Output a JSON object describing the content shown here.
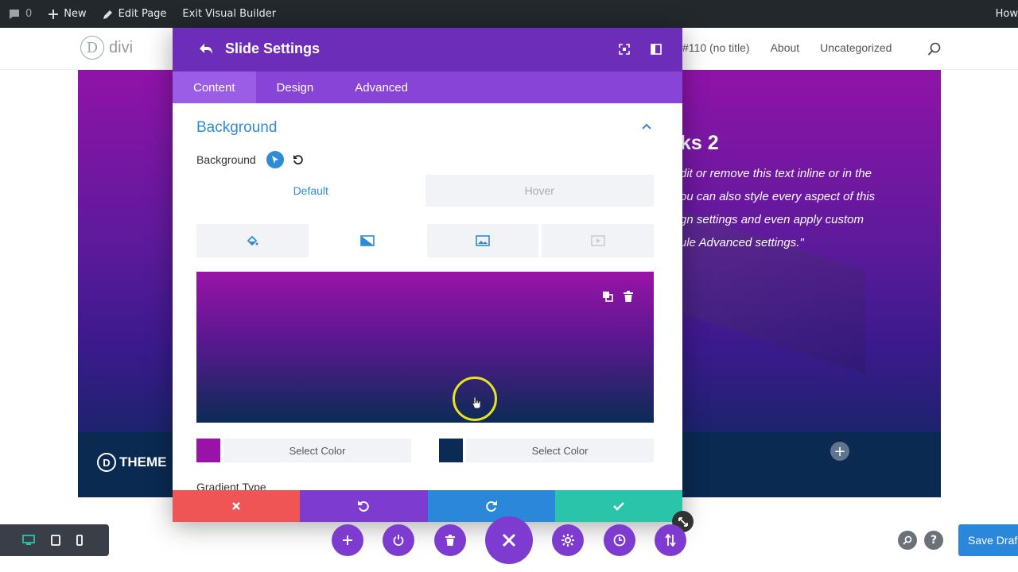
{
  "adminbar": {
    "comments_count": "0",
    "new_label": "New",
    "edit_page_label": "Edit Page",
    "exit_vb_label": "Exit Visual Builder",
    "howdy_label": "How"
  },
  "site": {
    "logo_letter": "D",
    "logo_text": "divi",
    "nav": [
      "#110 (no title)",
      "About",
      "Uncategorized"
    ]
  },
  "slide": {
    "title": "ks 2",
    "body_lines": [
      "dit or remove this text inline or in the",
      "ou can also style every aspect of this",
      "gn settings and even apply custom",
      "ule Advanced settings.\""
    ],
    "footer_logo_letter": "D",
    "footer_logo_text": "THEME",
    "add_row_symbol": "+"
  },
  "modal": {
    "title": "Slide Settings",
    "tabs": [
      "Content",
      "Design",
      "Advanced"
    ],
    "section_title": "Background",
    "background_label": "Background",
    "state_tabs": [
      "Default",
      "Hover"
    ],
    "type_tab_icons": [
      "paint-bucket-icon",
      "gradient-icon",
      "image-icon",
      "video-icon"
    ],
    "color1": {
      "label": "Select Color",
      "hex": "#9a13a8"
    },
    "color2": {
      "label": "Select Color",
      "hex": "#0b2b55"
    },
    "gradient_type_label": "Gradient Type"
  },
  "toolbar": {
    "help_symbol": "?",
    "save_draft_label": "Save Draft"
  },
  "colors": {
    "modal_header": "#6c2eb9",
    "tabs_bar": "#8844d6",
    "accent_blue": "#2e8bd6",
    "cancel_red": "#ef5555",
    "undo_purple": "#7e3bd0",
    "redo_blue": "#2b87da",
    "save_green": "#29c4a9"
  }
}
